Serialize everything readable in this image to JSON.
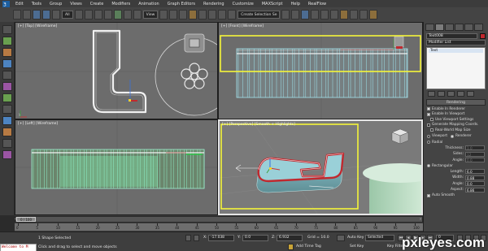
{
  "menu": [
    "Edit",
    "Tools",
    "Group",
    "Views",
    "Create",
    "Modifiers",
    "Animation",
    "Graph Editors",
    "Rendering",
    "Customize",
    "MAXScript",
    "Help",
    "RealFlow"
  ],
  "toolbar": {
    "filter_label": "All",
    "view_label": "View",
    "selection_set_label": "Create Selection Se"
  },
  "viewports": {
    "top": {
      "label": "[+] [Top] [Wireframe]"
    },
    "front": {
      "label": "[+] [Front] [Wireframe]"
    },
    "left": {
      "label": "[+] [Left] [Wireframe]"
    },
    "perspective": {
      "label": "[+] [Perspective] [Smooth + Highlights]"
    }
  },
  "highlight_color": "#f5f539",
  "object_color": "#c0292f",
  "command_panel": {
    "object_name": "Text008",
    "modifier_list_label": "Modifier List",
    "stack": [
      "Text"
    ],
    "rollout_title": "Rendering",
    "options": [
      {
        "label": "Enable In Renderer",
        "checked": true
      },
      {
        "label": "Enable In Viewport",
        "checked": true
      },
      {
        "label": "Use Viewport Settings",
        "checked": false
      },
      {
        "label": "Generate Mapping Coords.",
        "checked": false
      },
      {
        "label": "Real-World Map Size",
        "checked": false
      }
    ],
    "render_mode": {
      "viewport_label": "Viewport",
      "renderer_label": "Renderer"
    },
    "radial": {
      "label": "Radial",
      "thickness_label": "Thickness:",
      "thickness": "1.0",
      "sides_label": "Sides:",
      "sides": "12",
      "angle_label": "Angle:",
      "angle": "0.0"
    },
    "rectangular": {
      "label": "Rectangular",
      "length_label": "Length:",
      "length": "6.0",
      "width_label": "Width:",
      "width": "0.88",
      "angle_label": "Angle:",
      "angle": "0.0",
      "aspect_label": "Aspect:",
      "aspect": "6.86"
    },
    "auto_smooth_label": "Auto Smooth"
  },
  "timeline": {
    "frame_label": "0 / 100",
    "ticks": [
      "0",
      "5",
      "10",
      "15",
      "20",
      "25",
      "30",
      "35",
      "40",
      "45",
      "50",
      "55",
      "60",
      "65",
      "70",
      "75",
      "80",
      "85",
      "90",
      "95",
      "100"
    ]
  },
  "status": {
    "maxscript": "Welcome to M",
    "selection": "1 Shape Selected",
    "prompt": "Click and drag to select and move objects",
    "x_label": "X:",
    "x": "-17.038",
    "y_label": "Y:",
    "y": "0.0",
    "z_label": "Z:",
    "z": "6.932",
    "grid": "Grid = 10.0",
    "add_time_tag": "Add Time Tag",
    "auto_key": "Auto Key",
    "selected": "Selected",
    "set_key": "Set Key",
    "key_filters": "Key Filters...",
    "frame": "0"
  },
  "watermark": "pxleyes.com"
}
